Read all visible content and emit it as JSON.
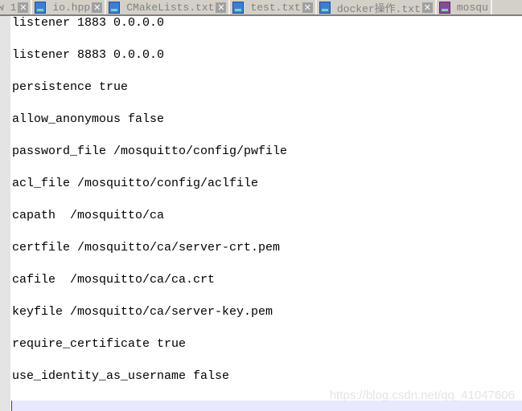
{
  "tabs": [
    {
      "label": "w 1",
      "icon": "file-icon"
    },
    {
      "label": "io.hpp",
      "icon": "file-icon"
    },
    {
      "label": "CMakeLists.txt",
      "icon": "file-icon"
    },
    {
      "label": "test.txt",
      "icon": "file-icon"
    },
    {
      "label": "docker操作.txt",
      "icon": "file-icon"
    },
    {
      "label": "mosqu",
      "icon": "file-icon"
    }
  ],
  "lines": [
    "listener 1883 0.0.0.0",
    "listener 8883 0.0.0.0",
    "persistence true",
    "allow_anonymous false",
    "password_file /mosquitto/config/pwfile",
    "acl_file /mosquitto/config/aclfile",
    "capath  /mosquitto/ca",
    "certfile /mosquitto/ca/server-crt.pem",
    "cafile  /mosquitto/ca/ca.crt",
    "keyfile /mosquitto/ca/server-key.pem",
    "require_certificate true",
    "use_identity_as_username false"
  ],
  "watermark": "https://blog.csdn.net/qq_41047606"
}
